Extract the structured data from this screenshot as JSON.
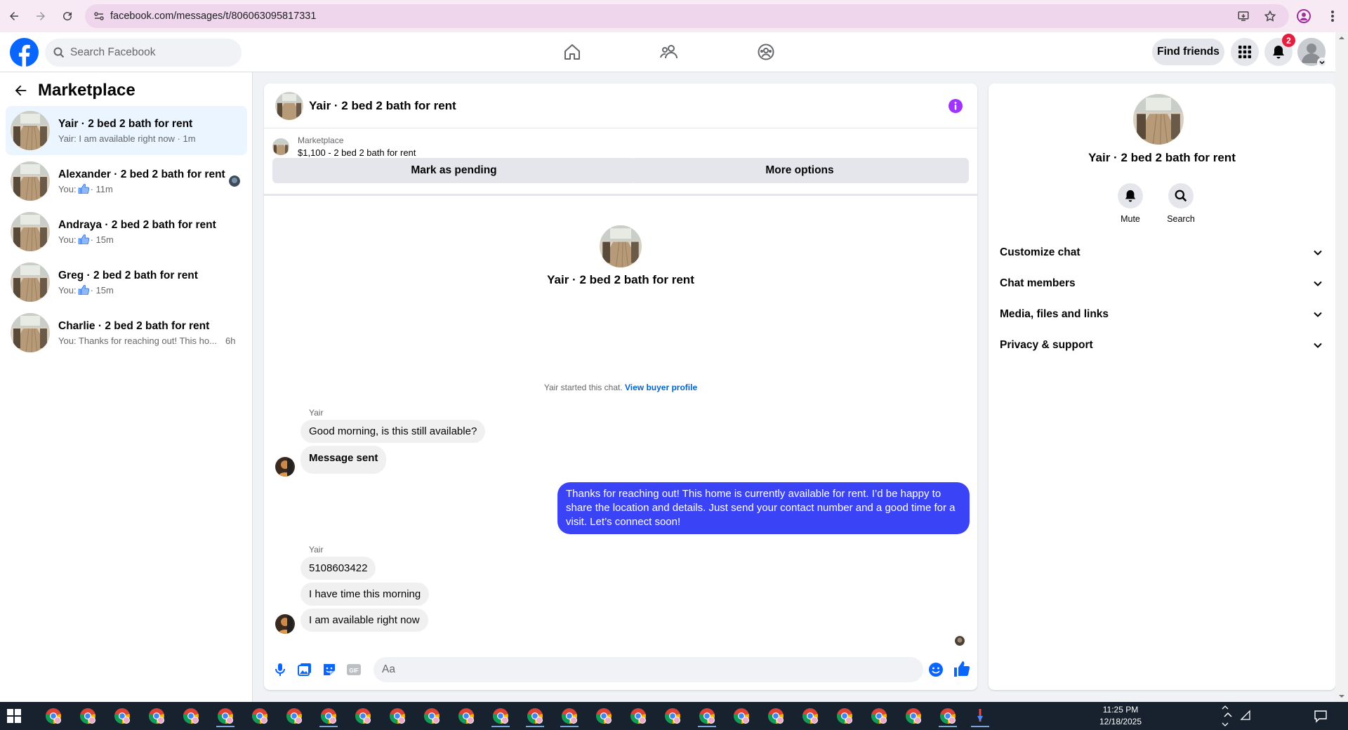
{
  "browser": {
    "url": "facebook.com/messages/t/806063095817331"
  },
  "header": {
    "search_placeholder": "Search Facebook",
    "find_friends": "Find friends",
    "notification_count": "2"
  },
  "sidebar": {
    "title": "Marketplace",
    "conversations": [
      {
        "name": "Yair · 2 bed 2 bath for rent",
        "preview": "Yair: I am available right now · 1m",
        "active": true
      },
      {
        "name": "Alexander · 2 bed 2 bath for rent",
        "preview_prefix": "You:",
        "preview_suffix": "· 11m",
        "icon": "thumbs-up-icon"
      },
      {
        "name": "Andraya · 2 bed 2 bath for rent",
        "preview_prefix": "You:",
        "preview_suffix": "· 15m",
        "icon": "thumbs-up-icon"
      },
      {
        "name": "Greg · 2 bed 2 bath for rent",
        "preview_prefix": "You:",
        "preview_suffix": "· 15m",
        "icon": "thumbs-up-icon"
      },
      {
        "name": "Charlie · 2 bed 2 bath for rent",
        "preview": "You: Thanks for reaching out! This ho...",
        "time": "6h"
      }
    ]
  },
  "chat": {
    "title": "Yair · 2 bed 2 bath for rent",
    "marketplace_label": "Marketplace",
    "listing": "$1,100 - 2 bed 2 bath for rent",
    "mark_pending": "Mark as pending",
    "more_options": "More options",
    "intro_title": "Yair · 2 bed 2 bath for rent",
    "started_text": "Yair started this chat.",
    "view_profile": "View buyer profile",
    "messages": {
      "sender_1": "Yair",
      "m1": "Good morning, is this still available?",
      "m2": "Message sent",
      "out1": "Thanks for reaching out! This home is currently available for rent. I’d be happy to share the location and details. Just send your contact number and a good time for a visit. Let’s connect soon!",
      "sender_2": "Yair",
      "m3": "5108603422",
      "m4": "I have time this morning",
      "m5": "I am available right now"
    },
    "composer_placeholder": "Aa"
  },
  "details": {
    "title": "Yair · 2 bed 2 bath for rent",
    "mute": "Mute",
    "search": "Search",
    "sections": [
      "Customize chat",
      "Chat members",
      "Media, files and links",
      "Privacy & support"
    ]
  },
  "taskbar": {
    "time": "11:25 PM",
    "date": "12/18/2025"
  },
  "colors": {
    "fb_blue": "#0866ff",
    "outgoing_bubble": "#3b43f6",
    "active_conv": "#ebf5ff",
    "info_purple": "#a033ff"
  }
}
